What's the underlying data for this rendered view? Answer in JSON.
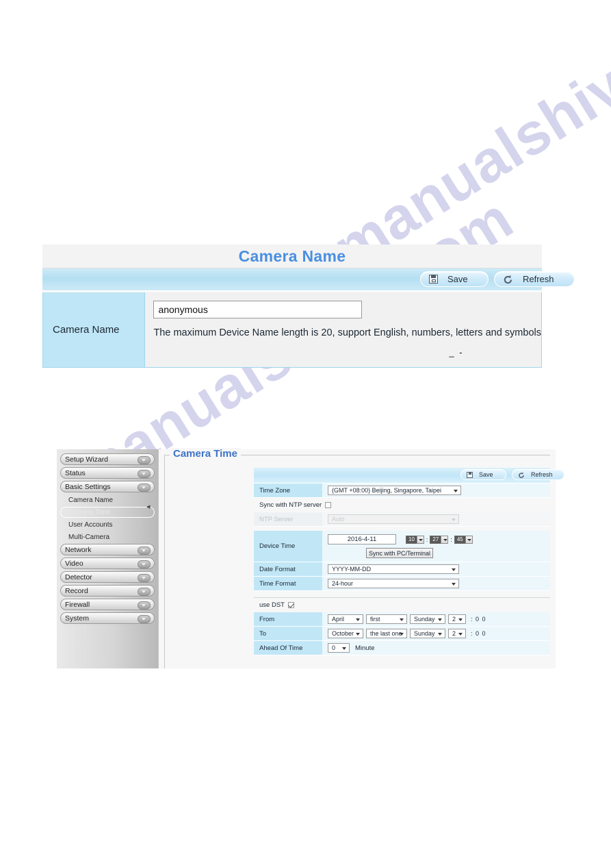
{
  "watermark": {
    "text": "manualshive.com"
  },
  "camera_name_panel": {
    "title": "Camera Name",
    "toolbar": {
      "save_label": "Save",
      "refresh_label": "Refresh",
      "save_icon": "floppy-disk-icon",
      "refresh_icon": "circular-arrow-icon"
    },
    "row": {
      "label": "Camera Name",
      "input_value": "anonymous",
      "input_placeholder": "",
      "hint": "The maximum Device Name length is 20, support English, numbers, letters and symbols",
      "artifact": "_ -"
    },
    "colors": {
      "title": "#4a8fe0",
      "label_cell": "#bfe6f6",
      "toolbar": "#c2e6f7"
    }
  },
  "camera_time_panel": {
    "legend": "Camera Time",
    "sidebar": {
      "groups": [
        {
          "label": "Setup Wizard",
          "type": "group"
        },
        {
          "label": "Status",
          "type": "group"
        },
        {
          "label": "Basic Settings",
          "type": "group"
        },
        {
          "label": "Camera Name",
          "type": "sub",
          "active": false
        },
        {
          "label": "Camera Time",
          "type": "sub",
          "active": true
        },
        {
          "label": "User Accounts",
          "type": "sub",
          "active": false
        },
        {
          "label": "Multi-Camera",
          "type": "sub",
          "active": false
        },
        {
          "label": "Network",
          "type": "group"
        },
        {
          "label": "Video",
          "type": "group"
        },
        {
          "label": "Detector",
          "type": "group"
        },
        {
          "label": "Record",
          "type": "group"
        },
        {
          "label": "Firewall",
          "type": "group"
        },
        {
          "label": "System",
          "type": "group"
        }
      ]
    },
    "toolbar": {
      "save_label": "Save",
      "refresh_label": "Refresh"
    },
    "time_zone": {
      "label": "Time Zone",
      "value": "(GMT +08:00) Beijing, Singapore, Taipei"
    },
    "sync_ntp": {
      "label": "Sync with NTP server",
      "checked": false
    },
    "ntp_server": {
      "label": "NTP Server",
      "value": "Auto",
      "disabled": true
    },
    "device_time": {
      "label": "Device Time",
      "date": "2016-4-11",
      "hour": "10",
      "minute": "27",
      "second": "45",
      "sync_button": "Sync with PC/Terminal"
    },
    "date_format": {
      "label": "Date Format",
      "value": "YYYY-MM-DD"
    },
    "time_format": {
      "label": "Time Format",
      "value": "24-hour"
    },
    "use_dst": {
      "label": "use DST",
      "checked": true
    },
    "dst_from": {
      "label": "From",
      "month": "April",
      "ordinal": "first",
      "weekday": "Sunday",
      "hour": "2",
      "suffix": ": 0 0"
    },
    "dst_to": {
      "label": "To",
      "month": "October",
      "ordinal": "the last one",
      "weekday": "Sunday",
      "hour": "2",
      "suffix": ": 0 0"
    },
    "ahead_of_time": {
      "label": "Ahead Of Time",
      "value": "0",
      "unit": "Minute"
    }
  }
}
